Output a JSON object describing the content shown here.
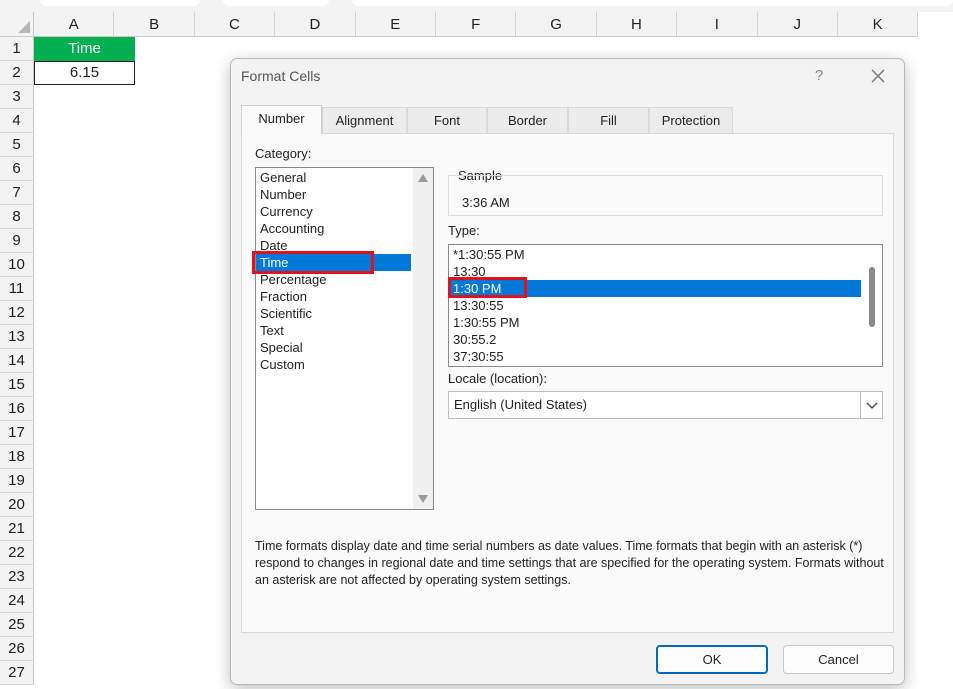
{
  "sheet": {
    "columns": [
      "A",
      "B",
      "C",
      "D",
      "E",
      "F",
      "G",
      "H",
      "I",
      "J",
      "K"
    ],
    "rows": [
      "1",
      "2",
      "3",
      "4",
      "5",
      "6",
      "7",
      "8",
      "9",
      "10",
      "11",
      "12",
      "13",
      "14",
      "15",
      "16",
      "17",
      "18",
      "19",
      "20",
      "21",
      "22",
      "23",
      "24",
      "25",
      "26",
      "27"
    ],
    "cells": {
      "a1": "Time",
      "a2": "6.15"
    },
    "colors": {
      "header_fill": "#00b050",
      "header_text": "#ffffff"
    }
  },
  "dialog": {
    "title": "Format Cells",
    "help_label": "?",
    "close_icon": "close-icon",
    "tabs": [
      "Number",
      "Alignment",
      "Font",
      "Border",
      "Fill",
      "Protection"
    ],
    "active_tab": "Number",
    "category_label": "Category:",
    "categories": [
      "General",
      "Number",
      "Currency",
      "Accounting",
      "Date",
      "Time",
      "Percentage",
      "Fraction",
      "Scientific",
      "Text",
      "Special",
      "Custom"
    ],
    "selected_category": "Time",
    "sample_label": "Sample",
    "sample_value": "3:36 AM",
    "type_label": "Type:",
    "types": [
      "*1:30:55 PM",
      "13:30",
      "1:30 PM",
      "13:30:55",
      "1:30:55 PM",
      "30:55.2",
      "37:30:55"
    ],
    "selected_type": "1:30 PM",
    "locale_label": "Locale (location):",
    "locale_value": "English (United States)",
    "description": "Time formats display date and time serial numbers as date values.  Time formats that begin with an asterisk (*) respond to changes in regional date and time settings that are specified for the operating system. Formats without an asterisk are not affected by operating system settings.",
    "ok_label": "OK",
    "cancel_label": "Cancel",
    "selection_color": "#0078d7",
    "highlight_color": "#e0121d"
  }
}
